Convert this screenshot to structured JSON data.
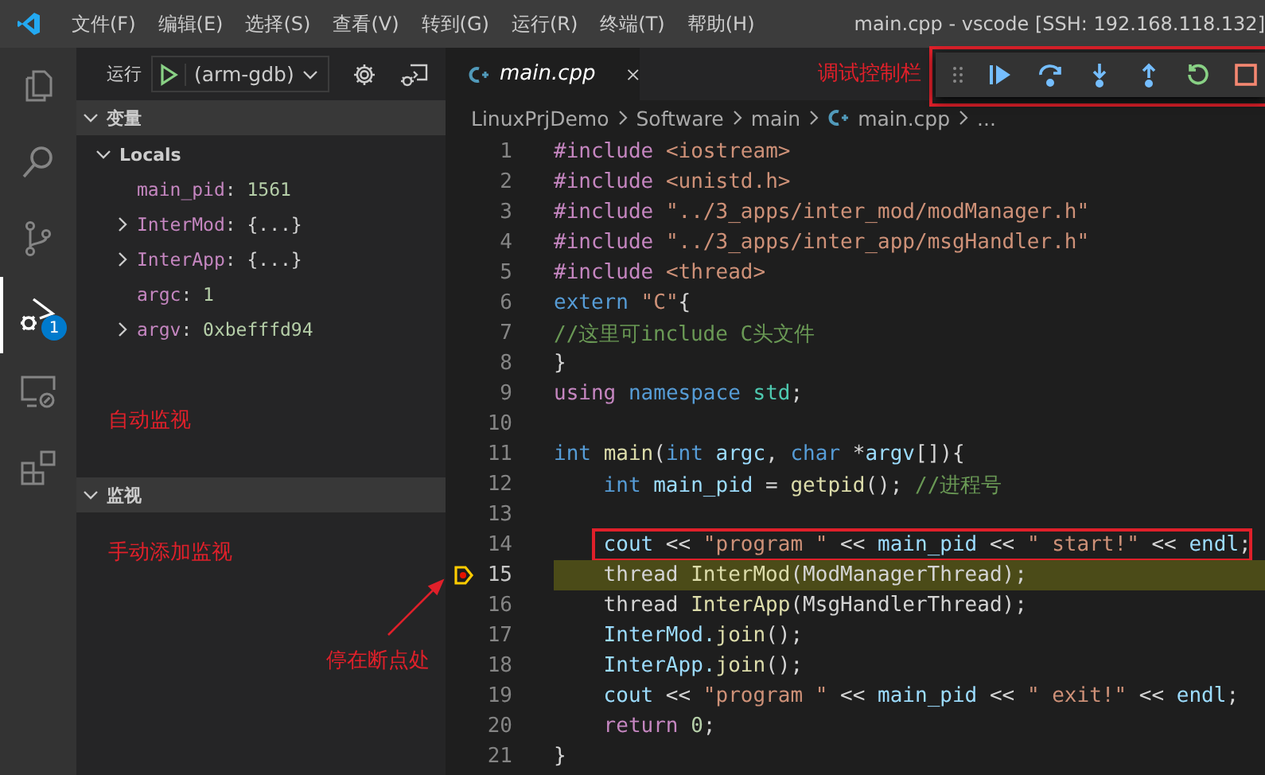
{
  "menu": {
    "items": [
      "文件(F)",
      "编辑(E)",
      "选择(S)",
      "查看(V)",
      "转到(G)",
      "运行(R)",
      "终端(T)",
      "帮助(H)"
    ],
    "title": "main.cpp - vscode [SSH: 192.168.118.132]"
  },
  "activity_bar": [
    {
      "kind": "files",
      "selected": false
    },
    {
      "kind": "search",
      "selected": false
    },
    {
      "kind": "source-control",
      "selected": false
    },
    {
      "kind": "debug",
      "selected": true,
      "badge": "1"
    },
    {
      "kind": "remote",
      "selected": false
    },
    {
      "kind": "extensions",
      "selected": false
    }
  ],
  "run_panel": {
    "label": "运行",
    "config": "(arm-gdb)"
  },
  "variables": {
    "title": "变量",
    "expanded": true,
    "scope": {
      "label": "Locals",
      "expanded": true
    },
    "items": [
      {
        "name": "main_pid",
        "sep": ":",
        "value": "1561",
        "expandable": false,
        "color": "#b5cea8"
      },
      {
        "name": "InterMod",
        "sep": ":",
        "value": "{...}",
        "expandable": true,
        "color": "#d4d4d4"
      },
      {
        "name": "InterApp",
        "sep": ":",
        "value": "{...}",
        "expandable": true,
        "color": "#d4d4d4"
      },
      {
        "name": "argc",
        "sep": ":",
        "value": "1",
        "expandable": false,
        "color": "#b5cea8"
      },
      {
        "name": "argv",
        "sep": ":",
        "value": "0xbefffd94",
        "expandable": true,
        "color": "#b5cea8"
      }
    ],
    "note": "自动监视"
  },
  "watch": {
    "title": "监视",
    "expanded": true,
    "note": "手动添加监视"
  },
  "breakpoint_note": "停在断点处",
  "editor": {
    "tab": {
      "label": "main.cpp",
      "selected": true
    },
    "breadcrumb": [
      "LinuxPrjDemo",
      "Software",
      "main",
      "main.cpp",
      "..."
    ],
    "lines": [
      {
        "number": "1",
        "indented": false,
        "tokens": [
          {
            "t": "#include ",
            "color": "#c586c0"
          },
          {
            "t": "<iostream>",
            "color": "#ce9178"
          }
        ]
      },
      {
        "number": "2",
        "indented": false,
        "tokens": [
          {
            "t": "#include ",
            "color": "#c586c0"
          },
          {
            "t": "<unistd.h>",
            "color": "#ce9178"
          }
        ]
      },
      {
        "number": "3",
        "indented": false,
        "tokens": [
          {
            "t": "#include ",
            "color": "#c586c0"
          },
          {
            "t": "\"../3_apps/inter_mod/modManager.h\"",
            "color": "#ce9178"
          }
        ]
      },
      {
        "number": "4",
        "indented": false,
        "tokens": [
          {
            "t": "#include ",
            "color": "#c586c0"
          },
          {
            "t": "\"../3_apps/inter_app/msgHandler.h\"",
            "color": "#ce9178"
          }
        ]
      },
      {
        "number": "5",
        "indented": false,
        "tokens": [
          {
            "t": "#include ",
            "color": "#c586c0"
          },
          {
            "t": "<thread>",
            "color": "#ce9178"
          }
        ]
      },
      {
        "number": "6",
        "indented": false,
        "tokens": [
          {
            "t": "extern ",
            "color": "#569cd6"
          },
          {
            "t": "\"C\"",
            "color": "#ce9178"
          },
          {
            "t": "{",
            "color": "#d4d4d4"
          }
        ]
      },
      {
        "number": "7",
        "indented": false,
        "tokens": [
          {
            "t": "//这里可include C头文件",
            "color": "#6a9955"
          }
        ]
      },
      {
        "number": "8",
        "indented": false,
        "tokens": [
          {
            "t": "}",
            "color": "#d4d4d4"
          }
        ]
      },
      {
        "number": "9",
        "indented": false,
        "tokens": [
          {
            "t": "using ",
            "color": "#c586c0"
          },
          {
            "t": "namespace ",
            "color": "#569cd6"
          },
          {
            "t": "std",
            "color": "#4ec9b0"
          },
          {
            "t": ";",
            "color": "#d4d4d4"
          }
        ]
      },
      {
        "number": "10"
      },
      {
        "number": "11",
        "indented": false,
        "tokens": [
          {
            "t": "int ",
            "color": "#569cd6"
          },
          {
            "t": "main",
            "color": "#dcdcaa"
          },
          {
            "t": "(",
            "color": "#d4d4d4"
          },
          {
            "t": "int ",
            "color": "#569cd6"
          },
          {
            "t": "argc",
            "color": "#9cdcfe"
          },
          {
            "t": ", ",
            "color": "#d4d4d4"
          },
          {
            "t": "char ",
            "color": "#569cd6"
          },
          {
            "t": "*",
            "color": "#d4d4d4"
          },
          {
            "t": "argv",
            "color": "#9cdcfe"
          },
          {
            "t": "[]){",
            "color": "#d4d4d4"
          }
        ]
      },
      {
        "number": "12",
        "indented": true,
        "tokens": [
          {
            "t": "int ",
            "color": "#569cd6"
          },
          {
            "t": "main_pid",
            "color": "#9cdcfe"
          },
          {
            "t": " = ",
            "color": "#d4d4d4"
          },
          {
            "t": "getpid",
            "color": "#dcdcaa"
          },
          {
            "t": "(); ",
            "color": "#d4d4d4"
          },
          {
            "t": "//进程号",
            "color": "#6a9955"
          }
        ]
      },
      {
        "number": "13"
      },
      {
        "number": "14",
        "indented": true,
        "highlighted": true,
        "tokens": [
          {
            "t": "cout",
            "color": "#9cdcfe"
          },
          {
            "t": " << ",
            "color": "#d4d4d4"
          },
          {
            "t": "\"program \"",
            "color": "#ce9178"
          },
          {
            "t": " << ",
            "color": "#d4d4d4"
          },
          {
            "t": "main_pid",
            "color": "#9cdcfe"
          },
          {
            "t": " << ",
            "color": "#d4d4d4"
          },
          {
            "t": "\" start!\"",
            "color": "#ce9178"
          },
          {
            "t": " << ",
            "color": "#d4d4d4"
          },
          {
            "t": "endl",
            "color": "#9cdcfe"
          },
          {
            "t": ";",
            "color": "#d4d4d4"
          }
        ]
      },
      {
        "number": "15",
        "indented": true,
        "current": true,
        "tokens": [
          {
            "t": "thread ",
            "color": "#d4d4d4"
          },
          {
            "t": "InterMod",
            "color": "#dcdcaa"
          },
          {
            "t": "(ModManagerThread);",
            "color": "#d4d4d4"
          }
        ]
      },
      {
        "number": "16",
        "indented": true,
        "current": false,
        "tokens": [
          {
            "t": "thread ",
            "color": "#d4d4d4"
          },
          {
            "t": "InterApp",
            "color": "#dcdcaa"
          },
          {
            "t": "(MsgHandlerThread);",
            "color": "#d4d4d4"
          }
        ]
      },
      {
        "number": "17",
        "indented": true,
        "tokens": [
          {
            "t": "InterMod.",
            "color": "#9cdcfe"
          },
          {
            "t": "join",
            "color": "#dcdcaa"
          },
          {
            "t": "();",
            "color": "#d4d4d4"
          }
        ]
      },
      {
        "number": "18",
        "indented": true,
        "tokens": [
          {
            "t": "InterApp.",
            "color": "#9cdcfe"
          },
          {
            "t": "join",
            "color": "#dcdcaa"
          },
          {
            "t": "();",
            "color": "#d4d4d4"
          }
        ]
      },
      {
        "number": "19",
        "indented": true,
        "tokens": [
          {
            "t": "cout",
            "color": "#9cdcfe"
          },
          {
            "t": " << ",
            "color": "#d4d4d4"
          },
          {
            "t": "\"program \"",
            "color": "#ce9178"
          },
          {
            "t": " << ",
            "color": "#d4d4d4"
          },
          {
            "t": "main_pid",
            "color": "#9cdcfe"
          },
          {
            "t": " << ",
            "color": "#d4d4d4"
          },
          {
            "t": "\" exit!\"",
            "color": "#ce9178"
          },
          {
            "t": " << ",
            "color": "#d4d4d4"
          },
          {
            "t": "endl",
            "color": "#9cdcfe"
          },
          {
            "t": ";",
            "color": "#d4d4d4"
          }
        ]
      },
      {
        "number": "20",
        "indented": true,
        "tokens": [
          {
            "t": "return ",
            "color": "#c586c0"
          },
          {
            "t": "0",
            "color": "#b5cea8"
          },
          {
            "t": ";",
            "color": "#d4d4d4"
          }
        ]
      },
      {
        "number": "21",
        "indented": false,
        "tokens": [
          {
            "t": "}",
            "color": "#d4d4d4"
          }
        ]
      }
    ]
  },
  "debug_toolbar": {
    "label": "调试控制栏",
    "buttons": [
      {
        "kind": "continue"
      },
      {
        "kind": "step-over"
      },
      {
        "kind": "step-into"
      },
      {
        "kind": "step-out"
      },
      {
        "kind": "restart"
      },
      {
        "kind": "stop"
      }
    ]
  }
}
